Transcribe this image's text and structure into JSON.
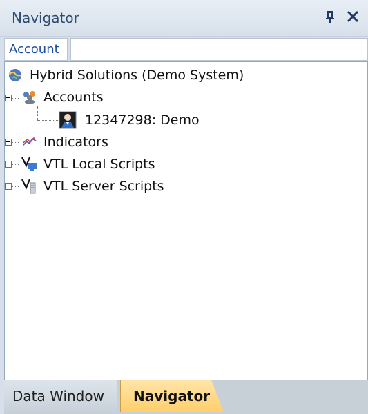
{
  "panel": {
    "title": "Navigator",
    "search": {
      "label": "Account",
      "value": "",
      "placeholder": ""
    },
    "tree": {
      "root": {
        "label": "Hybrid Solutions (Demo System)",
        "icon": "globe-icon"
      },
      "items": [
        {
          "label": "Accounts",
          "icon": "users-icon",
          "expanded": true
        },
        {
          "label": "12347298: Demo",
          "icon": "account-user-icon"
        },
        {
          "label": "Indicators",
          "icon": "indicators-chart-icon",
          "expanded": false
        },
        {
          "label": "VTL Local Scripts",
          "icon": "vtl-local-scripts-icon",
          "expanded": false
        },
        {
          "label": "VTL Server Scripts",
          "icon": "vtl-server-scripts-icon",
          "expanded": false
        }
      ]
    },
    "tabs": [
      {
        "label": "Data Window",
        "active": false
      },
      {
        "label": "Navigator",
        "active": true
      }
    ]
  },
  "colors": {
    "title_bg": "#d7e0ea",
    "title_text": "#2d4d73",
    "active_tab": "#ffcf6c",
    "tree_bg": "#ffffff"
  }
}
